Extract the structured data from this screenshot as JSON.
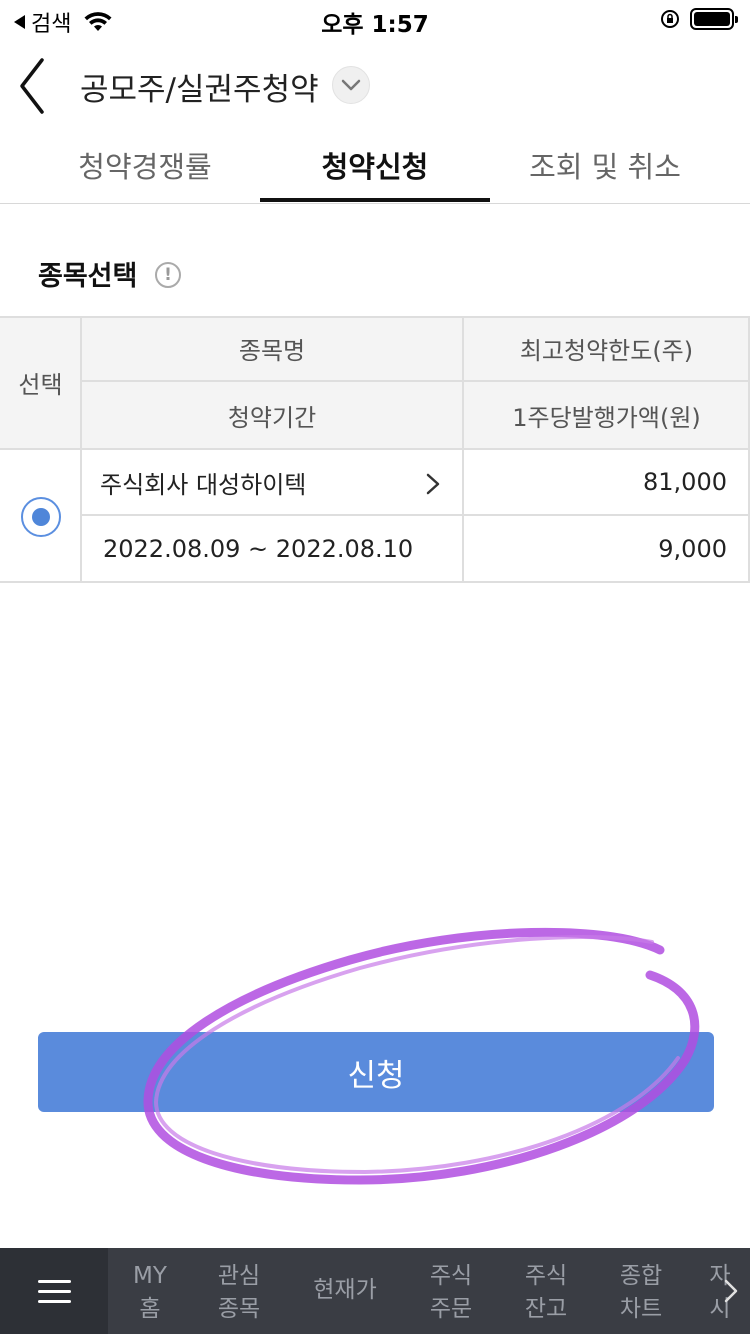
{
  "status_bar": {
    "back_app": "검색",
    "time": "오후 1:57"
  },
  "header": {
    "title": "공모주/실권주청약"
  },
  "tabs": [
    {
      "label": "청약경쟁률",
      "active": false
    },
    {
      "label": "청약신청",
      "active": true
    },
    {
      "label": "조회 및 취소",
      "active": false
    }
  ],
  "section": {
    "title": "종목선택",
    "info_icon": "!"
  },
  "table": {
    "headers": {
      "select": "선택",
      "name": "종목명",
      "max_limit": "최고청약한도(주)",
      "period": "청약기간",
      "price": "1주당발행가액(원)"
    },
    "rows": [
      {
        "selected": true,
        "name": "주식회사 대성하이텍",
        "max_limit": "81,000",
        "period": "2022.08.09 ~ 2022.08.10",
        "price": "9,000"
      }
    ]
  },
  "apply_button": {
    "label": "신청"
  },
  "bottom_nav": {
    "items": [
      {
        "line1": "MY",
        "line2": "홈"
      },
      {
        "line1": "관심",
        "line2": "종목"
      },
      {
        "line1": "현재가",
        "line2": ""
      },
      {
        "line1": "주식",
        "line2": "주문"
      },
      {
        "line1": "주식",
        "line2": "잔고"
      },
      {
        "line1": "종합",
        "line2": "차트"
      },
      {
        "line1": "자",
        "line2": "시"
      }
    ]
  },
  "colors": {
    "accent_blue": "#5a8bdc",
    "annotation_purple": "#b04de0",
    "bottom_nav_bg": "#3a3d44"
  },
  "icons": [
    "back-arrow-icon",
    "wifi-icon",
    "screen-lock-icon",
    "battery-icon",
    "chevron-down-icon",
    "info-icon",
    "chevron-right-icon",
    "menu-icon"
  ]
}
